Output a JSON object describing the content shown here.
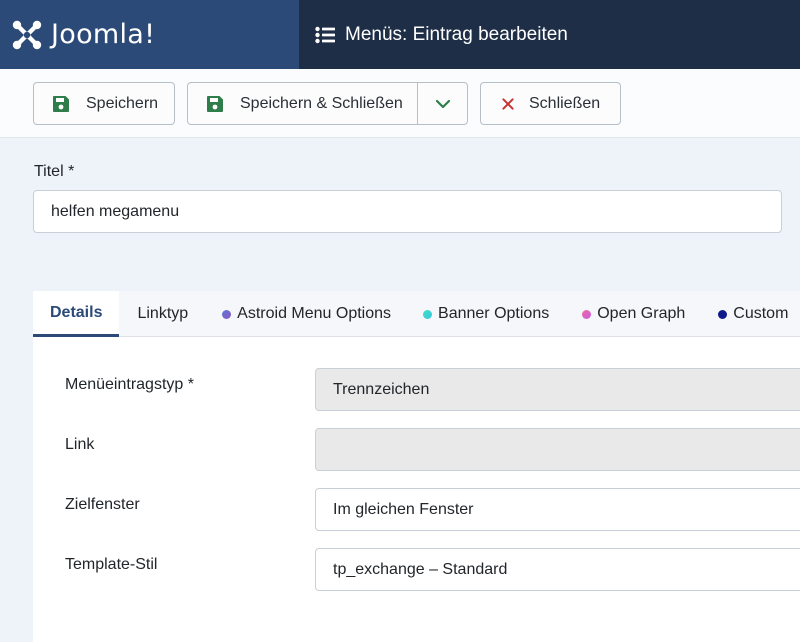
{
  "header": {
    "brand": "Joomla!",
    "page_title": "Menüs: Eintrag bearbeiten"
  },
  "toolbar": {
    "save_label": "Speichern",
    "save_close_label": "Speichern & Schließen",
    "close_label": "Schließen"
  },
  "title_field": {
    "label": "Titel *",
    "value": "helfen megamenu"
  },
  "tabs": [
    {
      "label": "Details"
    },
    {
      "label": "Linktyp"
    },
    {
      "label": "Astroid Menu Options",
      "dot_color": "#6a68c9"
    },
    {
      "label": "Banner Options",
      "dot_color": "#3dd6cf"
    },
    {
      "label": "Open Graph",
      "dot_color": "#e55fc0"
    },
    {
      "label": "Custom",
      "dot_color": "#0f1a8a"
    }
  ],
  "fields": [
    {
      "label": "Menüeintragstyp *",
      "value": "Trennzeichen"
    },
    {
      "label": "Link",
      "value": ""
    },
    {
      "label": "Zielfenster",
      "value": "Im gleichen Fenster"
    },
    {
      "label": "Template-Stil",
      "value": "tp_exchange – Standard"
    }
  ],
  "colors": {
    "header_bg": "#1f2e47",
    "brand_bg": "#2c4a77",
    "save_icon": "#2f7d4a",
    "close_icon": "#c9302c"
  }
}
